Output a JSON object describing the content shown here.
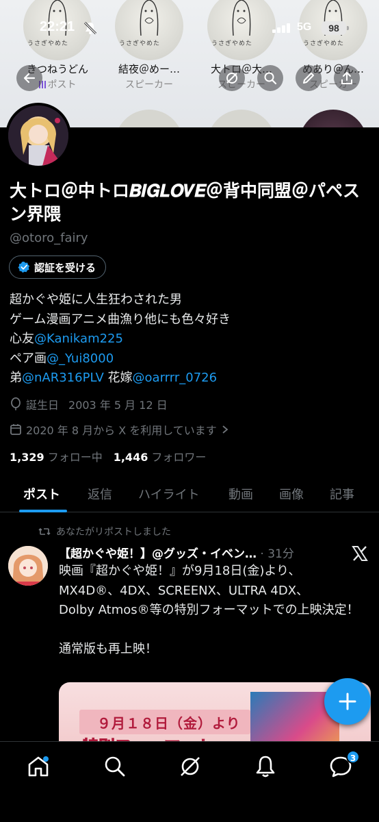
{
  "status_bar": {
    "time": "22:21",
    "network": "5G",
    "battery": "98"
  },
  "banner": {
    "caption": "うさぎやめた",
    "people": [
      {
        "name": "きつねうどん",
        "role": "ポスト"
      },
      {
        "name": "結夜＠めー…",
        "role": "スピーカー"
      },
      {
        "name": "大トロ＠大…",
        "role": "スピーカー"
      },
      {
        "name": "めあり＠ん…",
        "role": "スピーカー"
      }
    ]
  },
  "profile": {
    "display_name": "大トロ＠中トロ𝑩𝑰𝑮𝑳𝑶𝑽𝑬＠背中同盟＠パペスン界隈",
    "handle": "@otoro_fairy",
    "verify_label": "認証を受ける",
    "bio_lines": [
      "超かぐや姫に人生狂わされた男",
      "ゲーム漫画アニメ曲漁り他にも色々好き"
    ],
    "bio_bestfriend_label": "心友",
    "bio_bestfriend_link": "@Kanikam225",
    "bio_pair_label": "ペア画",
    "bio_pair_link": "@_Yui8000",
    "bio_brother_label": "弟",
    "bio_brother_link": "@nAR316PLV",
    "bio_bride_label": "花嫁",
    "bio_bride_link": "@oarrrr_0726",
    "birthday_label": "誕生日",
    "birthday": "2003 年 5 月 12 日",
    "joined": "2020 年 8 月から X を利用しています",
    "following_count": "1,329",
    "following_label": "フォロー中",
    "followers_count": "1,446",
    "followers_label": "フォロワー"
  },
  "tabs": [
    "ポスト",
    "返信",
    "ハイライト",
    "動画",
    "画像",
    "記事"
  ],
  "post": {
    "repost_label": "あなたがリポストしました",
    "author": "【超かぐや姫！】@グッズ・イベン…",
    "time": "· 31分",
    "text": "映画『超かぐや姫！』が9月18日(金)より、\nMX4D®、4DX、SCREENX、ULTRA 4DX、\nDolby Atmos®等の特別フォーマットでの上映決定！\n\n通常版も再上映！",
    "media_text": "９月１８日（金）より",
    "media_text2": "特別フォーマット"
  },
  "nav": {
    "notification_count": "3"
  },
  "colors": {
    "accent": "#1d9bf0",
    "background": "#000000",
    "secondary_text": "#71767b"
  }
}
